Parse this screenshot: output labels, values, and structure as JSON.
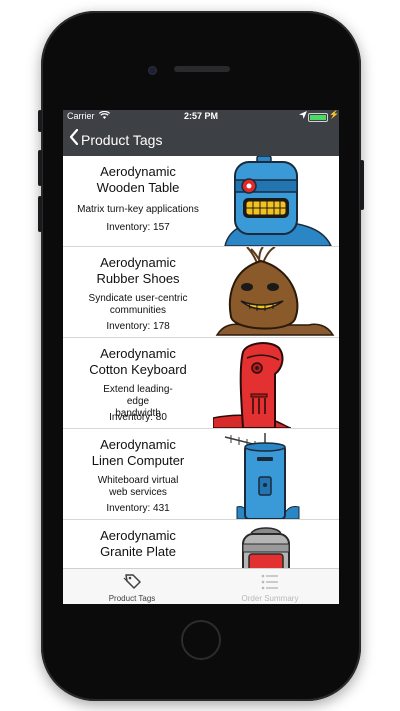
{
  "status_bar": {
    "carrier": "Carrier",
    "time": "2:57 PM"
  },
  "nav": {
    "title": "Product Tags"
  },
  "products": [
    {
      "name": "Aerodynamic\nWooden Table",
      "description": "Matrix turn-key applications",
      "inventory": "Inventory: 157",
      "robot": "blue-robot-grinning"
    },
    {
      "name": "Aerodynamic\nRubber Shoes",
      "description": "Syndicate user-centric communities",
      "inventory": "Inventory: 178",
      "robot": "brown-sack-robot"
    },
    {
      "name": "Aerodynamic\nCotton Keyboard",
      "description": "Extend leading-edge bandwidth",
      "inventory": "Inventory: 80",
      "robot": "red-robot"
    },
    {
      "name": "Aerodynamic\nLinen Computer",
      "description": "Whiteboard virtual web services",
      "inventory": "Inventory: 431",
      "robot": "blue-antenna-robot"
    },
    {
      "name": "Aerodynamic\nGranite Plate",
      "description": "",
      "inventory": "",
      "robot": "grey-robot"
    }
  ],
  "tabs": [
    {
      "label": "Product Tags",
      "icon": "tag-icon",
      "selected": true
    },
    {
      "label": "Order Summary",
      "icon": "list-icon",
      "selected": false
    }
  ],
  "colors": {
    "nav_bg": "#3d4044",
    "battery": "#4cd964",
    "tab_selected": "#3d4044",
    "tab_unselected": "#b8b8b8"
  }
}
